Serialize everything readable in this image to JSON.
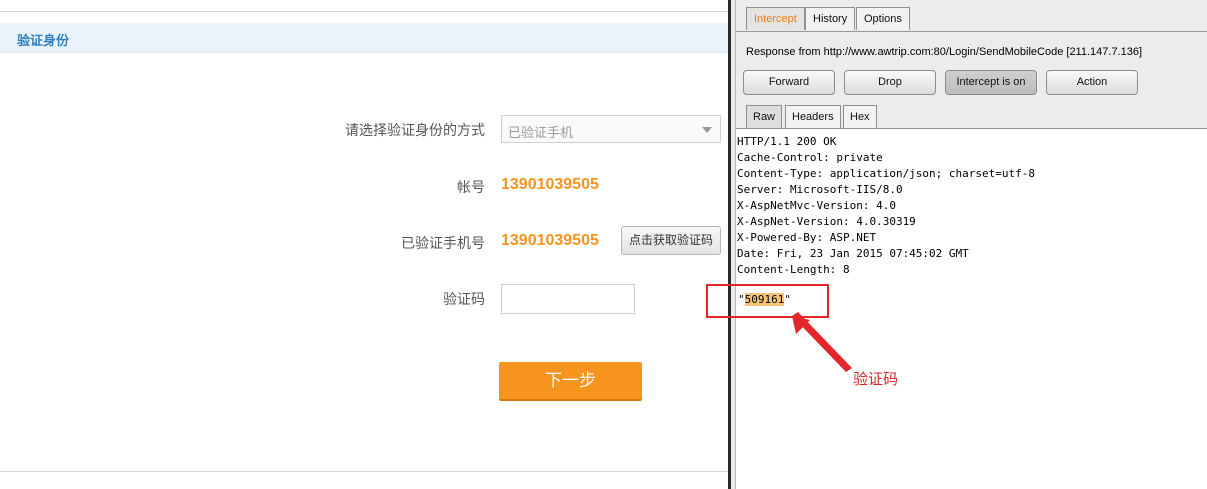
{
  "webpage": {
    "section_title": "验证身份",
    "method_label": "请选择验证身份的方式",
    "method_selected": "已验证手机",
    "account_label": "帐号",
    "account_value": "13901039505",
    "phone_label": "已验证手机号",
    "phone_value": "13901039505",
    "get_code_button": "点击获取验证码",
    "code_label": "验证码",
    "code_value": "",
    "next_button": "下一步"
  },
  "burp": {
    "tabs": [
      "Intercept",
      "History",
      "Options"
    ],
    "active_tab": "Intercept",
    "response_line": "Response from http://www.awtrip.com:80/Login/SendMobileCode  [211.147.7.136]",
    "buttons": {
      "forward": "Forward",
      "drop": "Drop",
      "intercept": "Intercept is on",
      "action": "Action"
    },
    "subtabs": [
      "Raw",
      "Headers",
      "Hex"
    ],
    "active_subtab": "Raw",
    "raw_lines": [
      "HTTP/1.1 200 OK",
      "Cache-Control: private",
      "Content-Type: application/json; charset=utf-8",
      "Server: Microsoft-IIS/8.0",
      "X-AspNetMvc-Version: 4.0",
      "X-AspNet-Version: 4.0.30319",
      "X-Powered-By: ASP.NET",
      "Date: Fri, 23 Jan 2015 07:45:02 GMT",
      "Content-Length: 8"
    ],
    "body_quote_open": "\"",
    "body_code": "509161",
    "body_quote_close": "\""
  },
  "annotation": {
    "label": "验证码",
    "color": "#e4262a"
  },
  "colors": {
    "accent_orange": "#f7941d",
    "value_orange": "#f7931e",
    "header_blue": "#2d7fc1"
  }
}
